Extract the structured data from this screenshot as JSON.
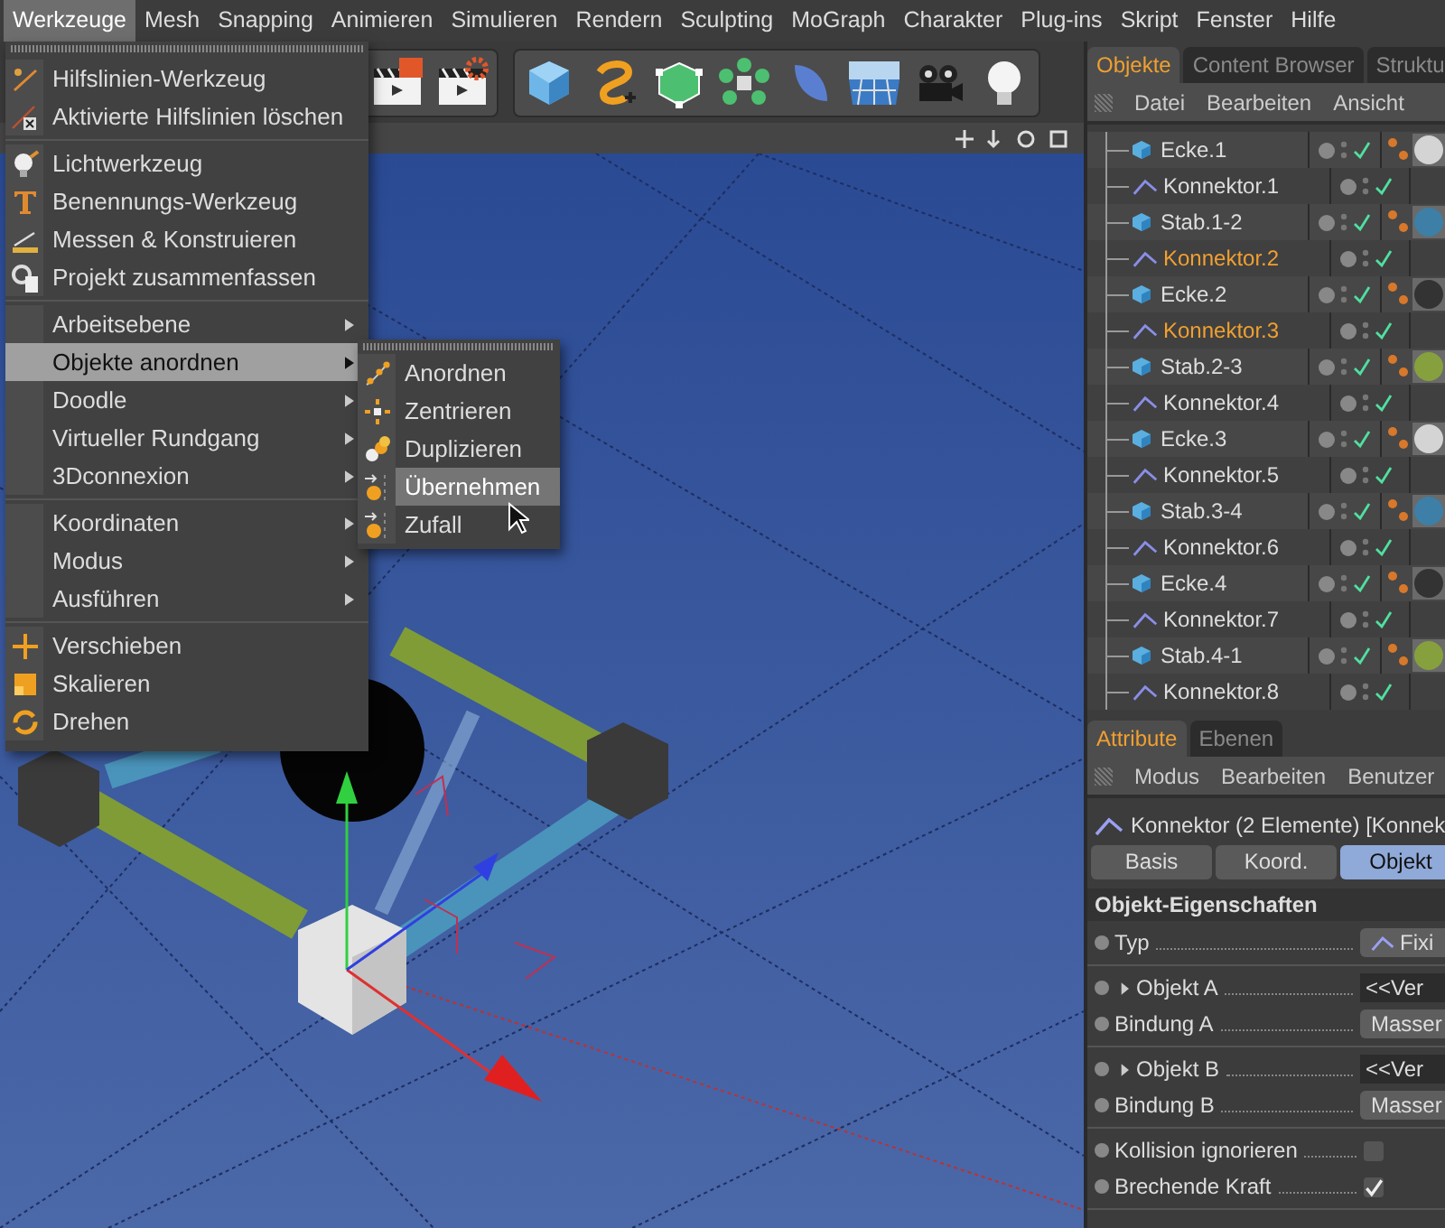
{
  "menu_bar": [
    {
      "label": "Werkzeuge",
      "selected": true
    },
    {
      "label": "Mesh",
      "selected": false
    },
    {
      "label": "Snapping",
      "selected": false
    },
    {
      "label": "Animieren",
      "selected": false
    },
    {
      "label": "Simulieren",
      "selected": false
    },
    {
      "label": "Rendern",
      "selected": false
    },
    {
      "label": "Sculpting",
      "selected": false
    },
    {
      "label": "MoGraph",
      "selected": false
    },
    {
      "label": "Charakter",
      "selected": false
    },
    {
      "label": "Plug-ins",
      "selected": false
    },
    {
      "label": "Skript",
      "selected": false
    },
    {
      "label": "Fenster",
      "selected": false
    },
    {
      "label": "Hilfe",
      "selected": false
    }
  ],
  "tools_menu": {
    "sections": [
      {
        "items": [
          {
            "label": "Hilfslinien-Werkzeug",
            "submenu": false,
            "selected": false
          },
          {
            "label": "Aktivierte Hilfslinien löschen",
            "submenu": false,
            "selected": false
          }
        ]
      },
      {
        "items": [
          {
            "label": "Lichtwerkzeug",
            "submenu": false,
            "selected": false
          },
          {
            "label": "Benennungs-Werkzeug",
            "submenu": false,
            "selected": false
          },
          {
            "label": "Messen & Konstruieren",
            "submenu": false,
            "selected": false
          },
          {
            "label": "Projekt zusammenfassen",
            "submenu": false,
            "selected": false
          }
        ]
      },
      {
        "items": [
          {
            "label": "Arbeitsebene",
            "submenu": true,
            "selected": false
          },
          {
            "label": "Objekte anordnen",
            "submenu": true,
            "selected": true
          },
          {
            "label": "Doodle",
            "submenu": true,
            "selected": false
          },
          {
            "label": "Virtueller Rundgang",
            "submenu": true,
            "selected": false
          },
          {
            "label": "3Dconnexion",
            "submenu": true,
            "selected": false
          }
        ]
      },
      {
        "items": [
          {
            "label": "Koordinaten",
            "submenu": true,
            "selected": false
          },
          {
            "label": "Modus",
            "submenu": true,
            "selected": false
          },
          {
            "label": "Ausführen",
            "submenu": true,
            "selected": false
          }
        ]
      },
      {
        "items": [
          {
            "label": "Verschieben",
            "submenu": false,
            "selected": false
          },
          {
            "label": "Skalieren",
            "submenu": false,
            "selected": false
          },
          {
            "label": "Drehen",
            "submenu": false,
            "selected": false
          }
        ]
      }
    ]
  },
  "arrange_submenu": {
    "items": [
      {
        "label": "Anordnen",
        "selected": false
      },
      {
        "label": "Zentrieren",
        "selected": false
      },
      {
        "label": "Duplizieren",
        "selected": false
      },
      {
        "label": "Übernehmen",
        "selected": true
      },
      {
        "label": "Zufall",
        "selected": false
      }
    ]
  },
  "object_manager": {
    "tabs": [
      {
        "label": "Objekte",
        "selected": true
      },
      {
        "label": "Content Browser",
        "selected": false
      },
      {
        "label": "Struktu",
        "selected": false
      }
    ],
    "menu": [
      "Datei",
      "Bearbeiten",
      "Ansicht"
    ],
    "objects": [
      {
        "name": "Ecke.1",
        "kind": "polygon",
        "selected": false,
        "material": {
          "color": "#d4d4d4"
        }
      },
      {
        "name": "Konnektor.1",
        "kind": "connector",
        "selected": false
      },
      {
        "name": "Stab.1-2",
        "kind": "polygon",
        "selected": false,
        "material": {
          "color": "#3d7fa6"
        }
      },
      {
        "name": "Konnektor.2",
        "kind": "connector",
        "selected": true
      },
      {
        "name": "Ecke.2",
        "kind": "polygon",
        "selected": false,
        "material": {
          "color": "#333333"
        }
      },
      {
        "name": "Konnektor.3",
        "kind": "connector",
        "selected": true
      },
      {
        "name": "Stab.2-3",
        "kind": "polygon",
        "selected": false,
        "material": {
          "color": "#86a03e"
        }
      },
      {
        "name": "Konnektor.4",
        "kind": "connector",
        "selected": false
      },
      {
        "name": "Ecke.3",
        "kind": "polygon",
        "selected": false,
        "material": {
          "color": "#d4d4d4"
        }
      },
      {
        "name": "Konnektor.5",
        "kind": "connector",
        "selected": false
      },
      {
        "name": "Stab.3-4",
        "kind": "polygon",
        "selected": false,
        "material": {
          "color": "#3d7fa6"
        }
      },
      {
        "name": "Konnektor.6",
        "kind": "connector",
        "selected": false
      },
      {
        "name": "Ecke.4",
        "kind": "polygon",
        "selected": false,
        "material": {
          "color": "#333333"
        }
      },
      {
        "name": "Konnektor.7",
        "kind": "connector",
        "selected": false
      },
      {
        "name": "Stab.4-1",
        "kind": "polygon",
        "selected": false,
        "material": {
          "color": "#86a03e"
        }
      },
      {
        "name": "Konnektor.8",
        "kind": "connector",
        "selected": false
      }
    ]
  },
  "attributes": {
    "tabs": [
      {
        "label": "Attribute",
        "selected": true
      },
      {
        "label": "Ebenen",
        "selected": false
      }
    ],
    "menu": [
      "Modus",
      "Bearbeiten",
      "Benutzer"
    ],
    "title": "Konnektor (2 Elemente) [Konnek",
    "mode_tabs": [
      {
        "label": "Basis",
        "selected": false
      },
      {
        "label": "Koord.",
        "selected": false
      },
      {
        "label": "Objekt",
        "selected": true
      }
    ],
    "section": "Objekt-Eigenschaften",
    "groups": [
      {
        "rows": [
          {
            "label": "Typ",
            "kind": "icon-button",
            "value": "Fixi"
          }
        ]
      },
      {
        "rows": [
          {
            "label": "Objekt A",
            "kind": "link",
            "expanded": false,
            "value": "<<Ver"
          },
          {
            "label": "Bindung A",
            "kind": "button",
            "value": "Masser"
          }
        ]
      },
      {
        "rows": [
          {
            "label": "Objekt B",
            "kind": "link",
            "expanded": false,
            "value": "<<Ver"
          },
          {
            "label": "Bindung B",
            "kind": "button",
            "value": "Masser"
          }
        ]
      },
      {
        "rows": [
          {
            "label": "Kollision ignorieren",
            "kind": "checkbox",
            "checked": false
          },
          {
            "label": "Brechende Kraft",
            "kind": "checkbox",
            "checked": true
          }
        ]
      }
    ]
  }
}
